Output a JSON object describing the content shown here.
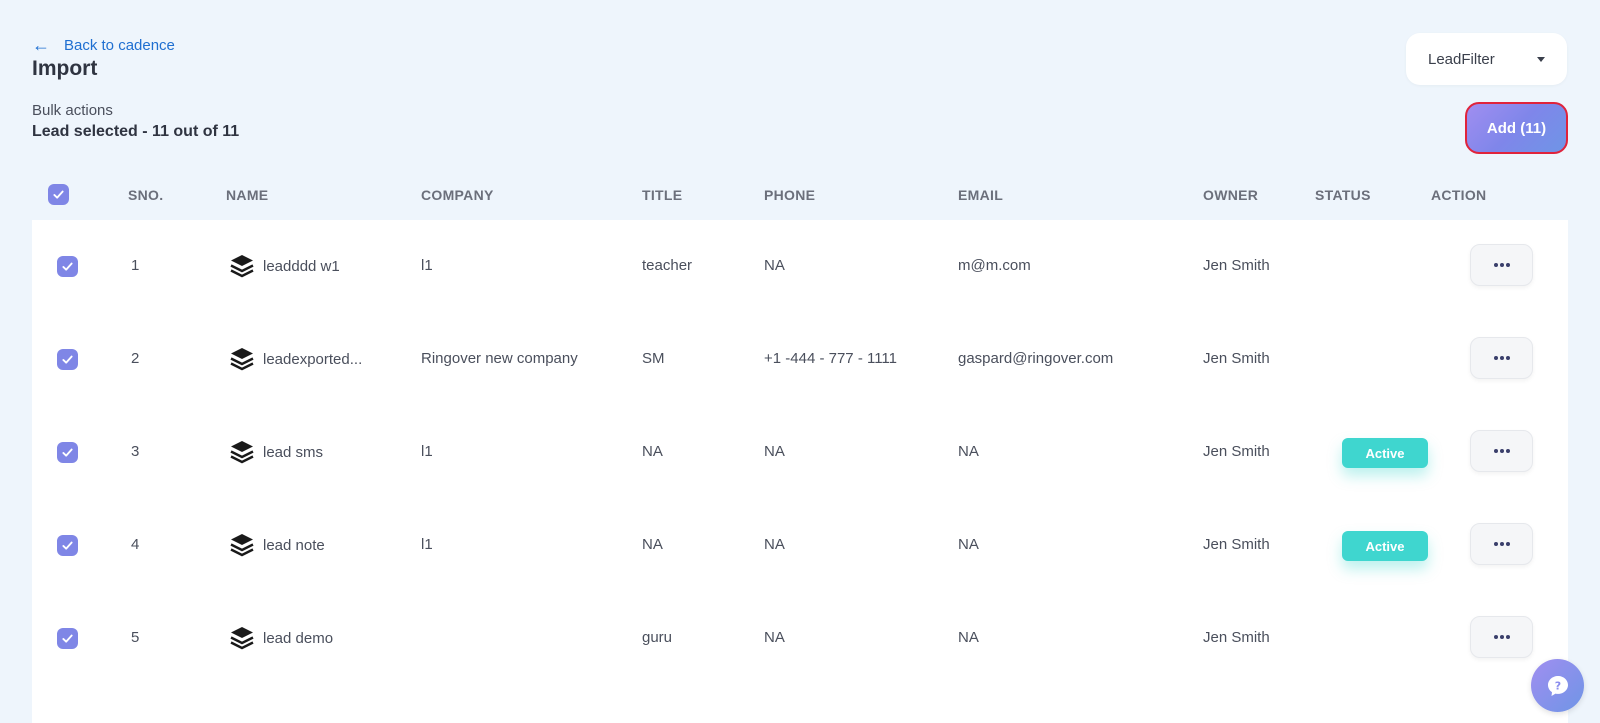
{
  "nav": {
    "back_label": "Back to cadence",
    "back_icon": "arrow-left-icon"
  },
  "page": {
    "title": "Import",
    "bulk_actions_label": "Bulk actions",
    "lead_selected_text": "Lead selected - 11 out of 11"
  },
  "filter": {
    "selected": "LeadFilter"
  },
  "add_button": {
    "label": "Add (11)"
  },
  "colors": {
    "accent": "#7f86e6",
    "link": "#1f6fd1",
    "status_active": "#3fd6cf",
    "add_button_border": "#e0233b"
  },
  "table": {
    "headers": {
      "sno": "SNO.",
      "name": "NAME",
      "company": "COMPANY",
      "title": "TITLE",
      "phone": "PHONE",
      "email": "EMAIL",
      "owner": "OWNER",
      "status": "STATUS",
      "action": "ACTION"
    },
    "all_selected": true,
    "rows": [
      {
        "sno": "1",
        "name": "leadddd w1",
        "company": "l1",
        "title": "teacher",
        "phone": "NA",
        "email": "m@m.com",
        "owner": "Jen Smith",
        "status": "",
        "selected": true
      },
      {
        "sno": "2",
        "name": "leadexported...",
        "company": "Ringover new company",
        "title": "SM",
        "phone": "+1 -444 - 777 - 1111",
        "email": "gaspard@ringover.com",
        "owner": "Jen Smith",
        "status": "",
        "selected": true
      },
      {
        "sno": "3",
        "name": "lead sms",
        "company": "l1",
        "title": "NA",
        "phone": "NA",
        "email": "NA",
        "owner": "Jen Smith",
        "status": "Active",
        "selected": true
      },
      {
        "sno": "4",
        "name": "lead note",
        "company": "l1",
        "title": "NA",
        "phone": "NA",
        "email": "NA",
        "owner": "Jen Smith",
        "status": "Active",
        "selected": true
      },
      {
        "sno": "5",
        "name": "lead demo",
        "company": "",
        "title": "guru",
        "phone": "NA",
        "email": "NA",
        "owner": "Jen Smith",
        "status": "",
        "selected": true
      }
    ]
  },
  "help": {
    "icon": "help-chat-icon"
  }
}
